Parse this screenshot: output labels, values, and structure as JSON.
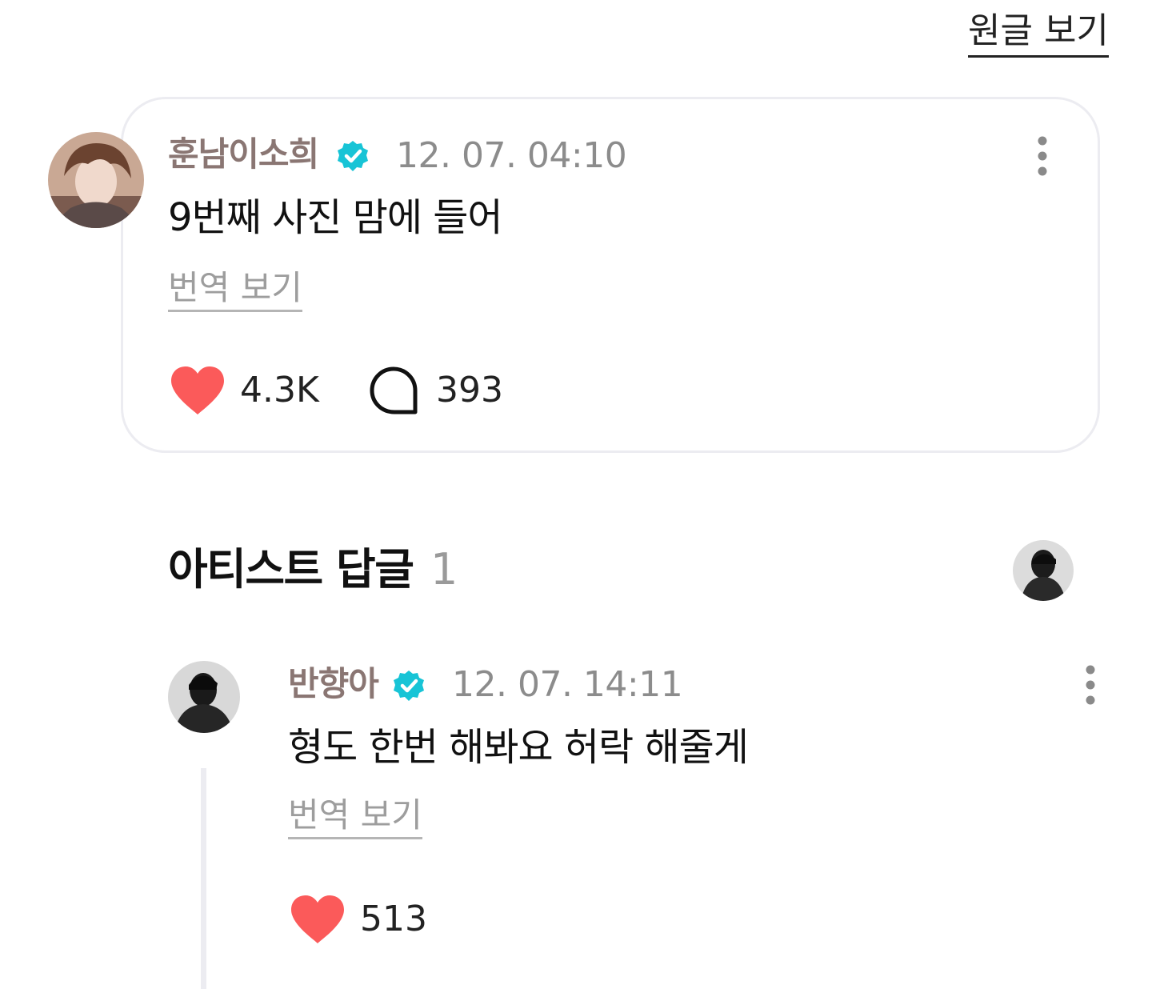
{
  "header": {
    "view_original_label": "원글 보기"
  },
  "post": {
    "author": "훈남이소희",
    "timestamp": "12. 07. 04:10",
    "text": "9번째 사진 맘에 들어",
    "translate_label": "번역 보기",
    "likes": "4.3K",
    "comments": "393"
  },
  "artist_replies": {
    "title": "아티스트 답글",
    "count": "1"
  },
  "reply": {
    "author": "반향아",
    "timestamp": "12. 07. 14:11",
    "text": "형도 한번 해봐요 허락 해줄게",
    "translate_label": "번역 보기",
    "likes": "513"
  },
  "colors": {
    "author_name": "#8a7673",
    "verified_badge": "#17c4d6",
    "heart": "#fb5a5a",
    "muted_text": "#8c8c8c",
    "card_border": "#ececf1"
  },
  "icons": [
    "verified-badge-icon",
    "more-options-icon",
    "heart-icon",
    "comment-icon"
  ]
}
